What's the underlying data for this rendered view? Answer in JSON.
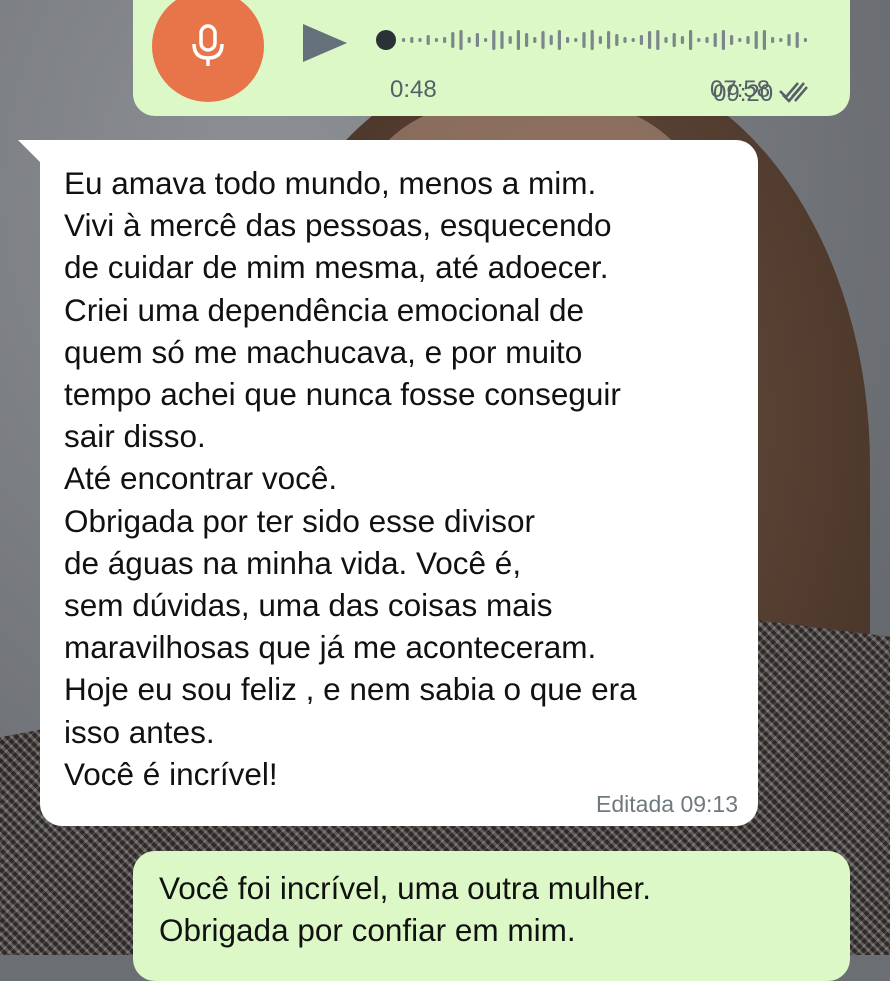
{
  "voice_message": {
    "duration": "0:48",
    "time": "07:58",
    "status_icon": "double-check-icon",
    "mic_color": "#e8744a"
  },
  "incoming_message": {
    "lines": [
      "Eu amava todo mundo, menos a mim.",
      "Vivi à mercê das pessoas, esquecendo",
      "de cuidar de mim mesma, até adoecer.",
      "Criei uma dependência emocional de",
      "quem só me machucava, e por muito",
      "tempo achei que nunca fosse conseguir",
      "sair disso.",
      "Até encontrar você.",
      "Obrigada por ter sido esse divisor",
      "de águas na minha vida. Você é,",
      "sem dúvidas, uma das coisas mais",
      "maravilhosas que já me aconteceram.",
      "Hoje eu sou feliz , e nem sabia o que era",
      "isso antes.",
      "Você é incrível!"
    ],
    "footer": "Editada 09:13"
  },
  "reply_message": {
    "lines": [
      "Você foi incrível, uma outra mulher.",
      "Obrigada por confiar em mim."
    ],
    "time": "09:20",
    "status_icon": "double-check-icon"
  },
  "colors": {
    "outgoing_bubble": "#dcf8c6",
    "incoming_bubble": "#ffffff",
    "meta_text": "#556068"
  }
}
